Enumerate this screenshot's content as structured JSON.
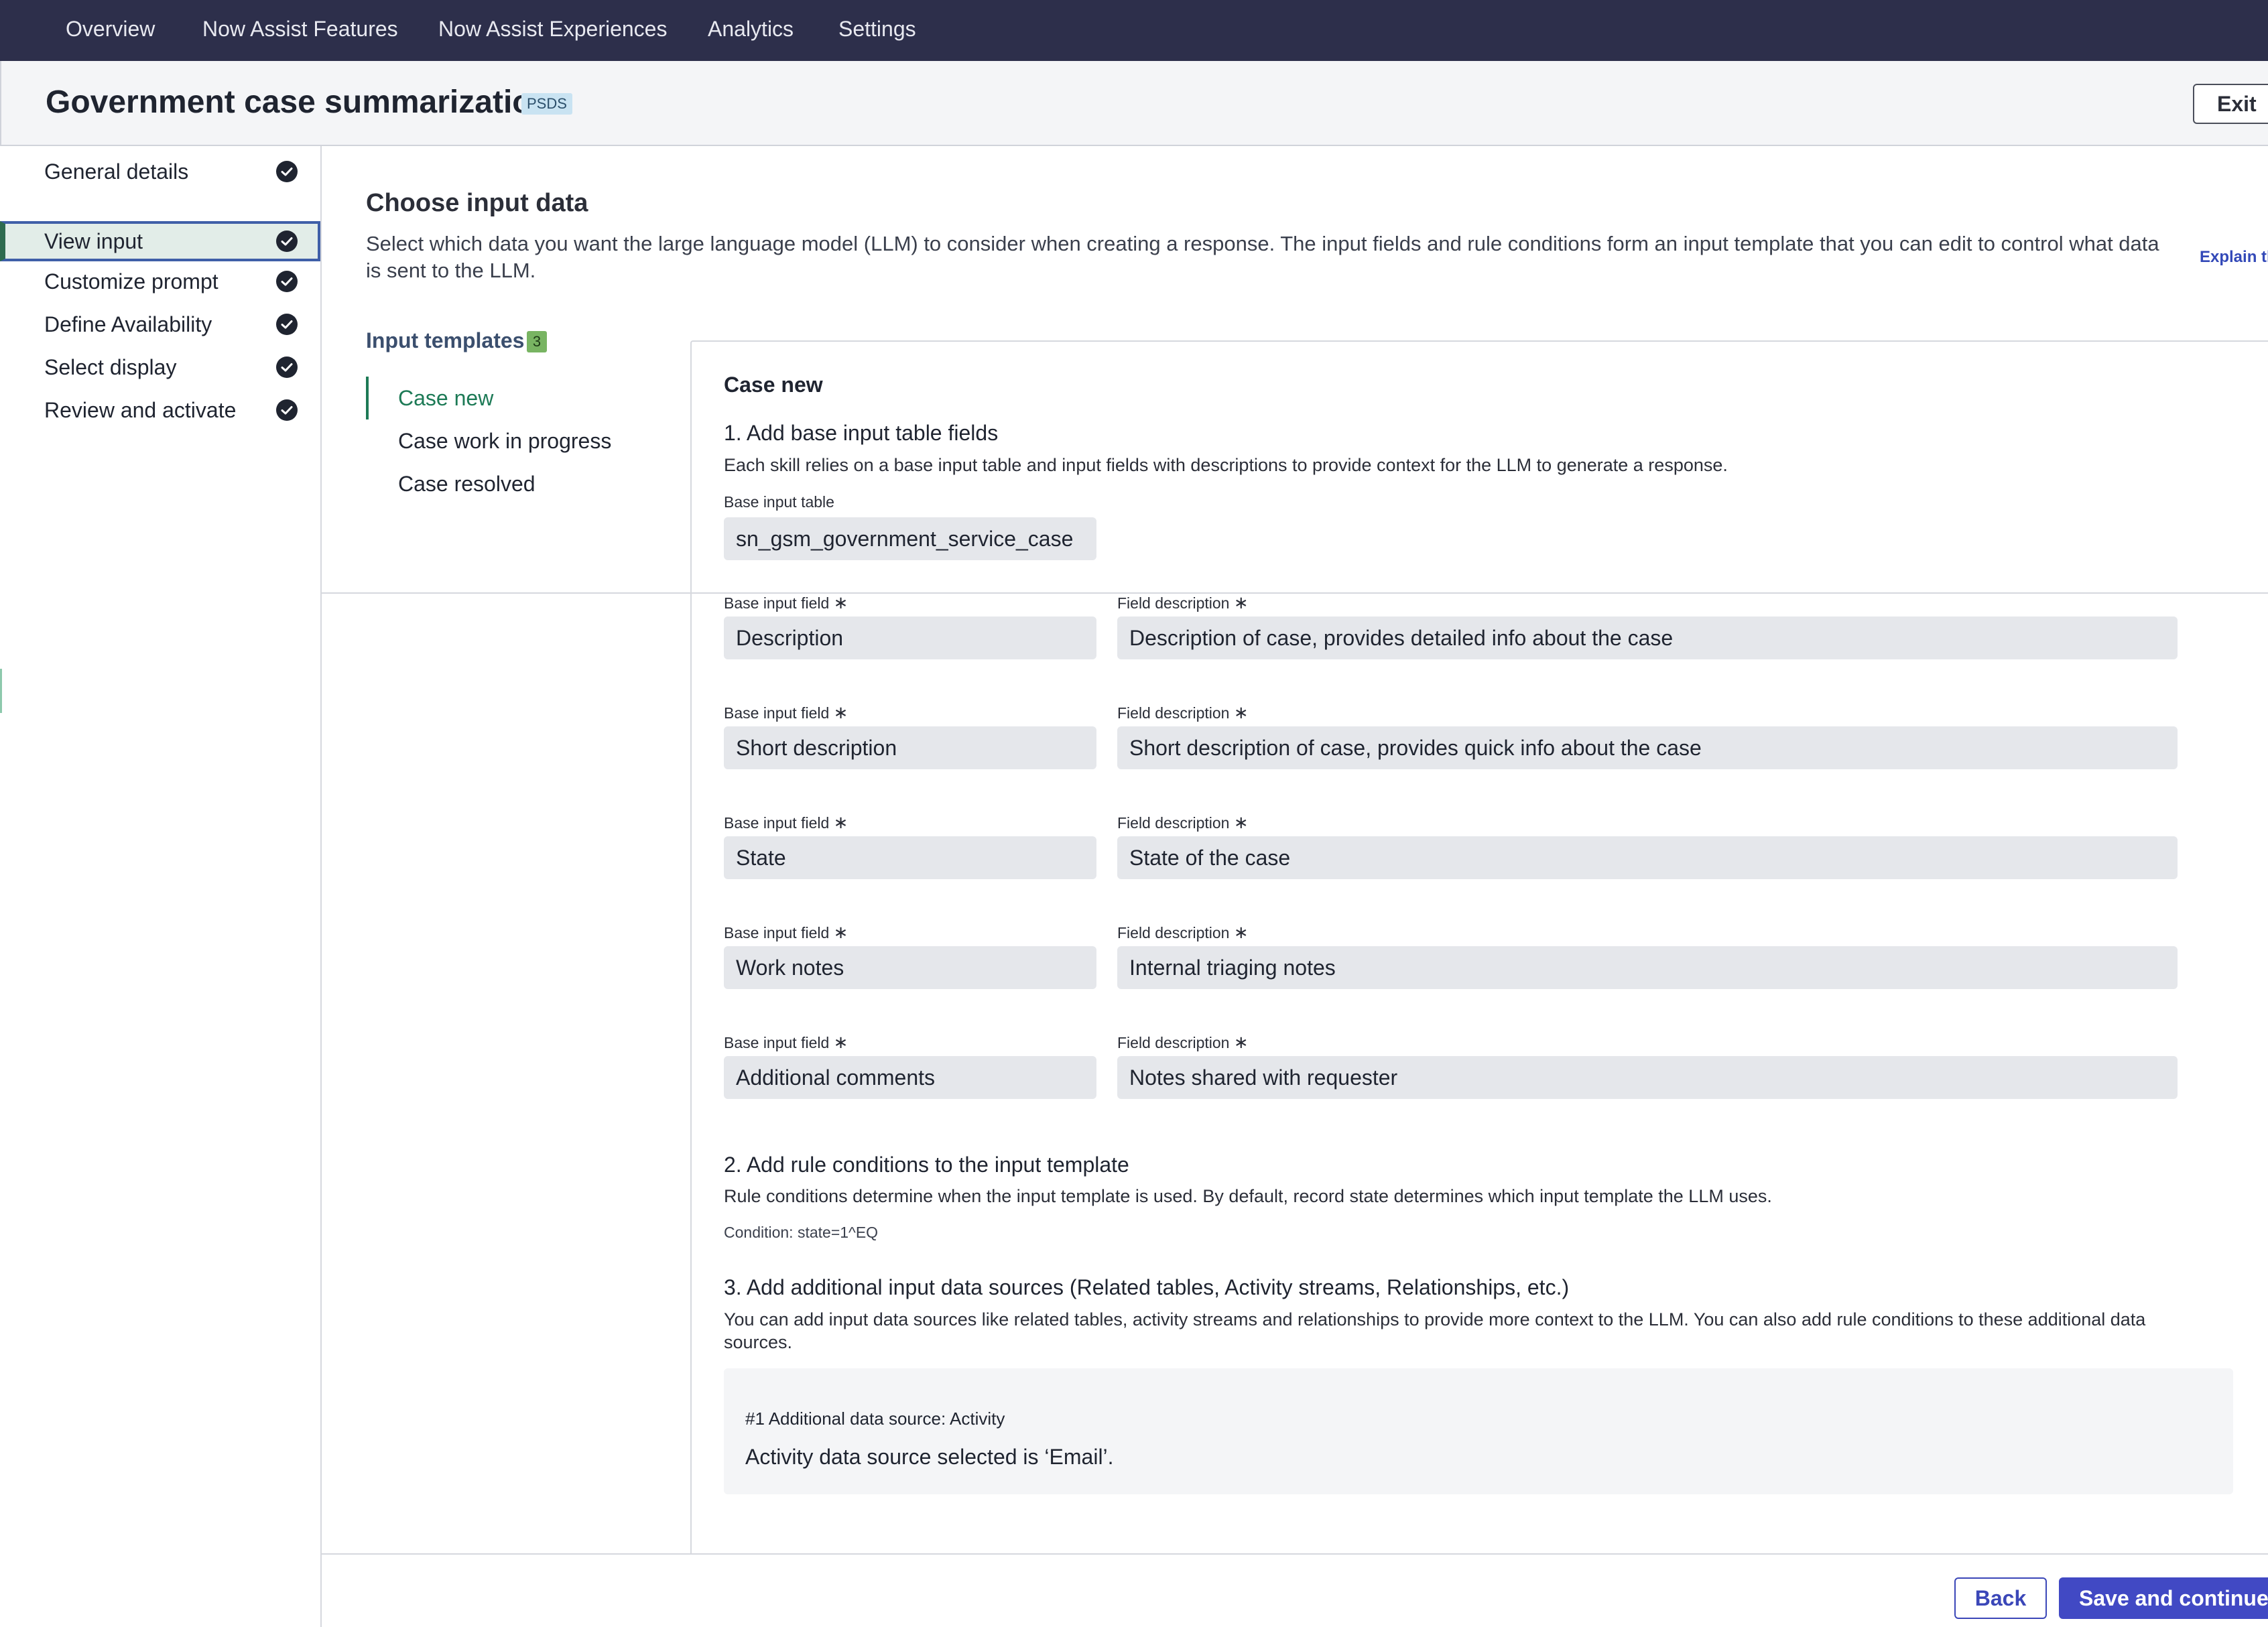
{
  "nav": {
    "items": [
      {
        "label": "Overview"
      },
      {
        "label": "Now Assist Features"
      },
      {
        "label": "Now Assist Experiences"
      },
      {
        "label": "Analytics"
      },
      {
        "label": "Settings"
      }
    ]
  },
  "header": {
    "title": "Government case summarization",
    "badge": "PSDS",
    "exit_label": "Exit"
  },
  "stepper": {
    "steps": [
      {
        "label": "General details",
        "icon": "check-circle-icon"
      },
      {
        "label": "View input",
        "icon": "check-circle-icon",
        "active": true
      },
      {
        "label": "Customize prompt",
        "icon": "check-circle-icon"
      },
      {
        "label": "Define Availability",
        "icon": "check-circle-icon"
      },
      {
        "label": "Select display",
        "icon": "check-circle-icon"
      },
      {
        "label": "Review and activate",
        "icon": "check-circle-icon"
      }
    ]
  },
  "main": {
    "title": "Choose input data",
    "description": "Select which data you want the large language model (LLM) to consider when creating a response. The input fields and rule conditions form an input template that you can edit to control what data is sent to the LLM.",
    "explain_link": "Explain th"
  },
  "templates": {
    "title": "Input templates",
    "count": "3",
    "items": [
      {
        "label": "Case new",
        "active": true
      },
      {
        "label": "Case work in progress"
      },
      {
        "label": "Case resolved"
      }
    ]
  },
  "card": {
    "title": "Case new",
    "section1": {
      "title": "1. Add base input table fields",
      "description": "Each skill relies on a base input table and input fields with descriptions to provide context for the LLM to generate a response.",
      "table_label": "Base input table",
      "table_value": "sn_gsm_government_service_case",
      "field_label": "Base input field",
      "desc_label": "Field description",
      "required_mark": "∗",
      "rows": [
        {
          "field": "Description",
          "description": "Description of case, provides detailed info about the case"
        },
        {
          "field": "Short description",
          "description": "Short description of case, provides quick info about the case"
        },
        {
          "field": "State",
          "description": "State of the case"
        },
        {
          "field": "Work notes",
          "description": "Internal triaging notes"
        },
        {
          "field": "Additional comments",
          "description": "Notes shared with requester"
        }
      ]
    },
    "section2": {
      "title": "2. Add rule conditions to the input template",
      "description": "Rule conditions determine when the input template is used. By default, record state determines which input template the LLM uses.",
      "condition": "Condition: state=1^EQ"
    },
    "section3": {
      "title": "3. Add additional input data sources (Related tables, Activity streams, Relationships, etc.)",
      "description": "You can add input data sources like related tables, activity streams and relationships to provide more context to the LLM. You can also add rule conditions to these additional data sources.",
      "source_title": "#1 Additional data source: Activity",
      "source_text": "Activity data source selected is ‘Email’."
    }
  },
  "footer": {
    "back_label": "Back",
    "save_label": "Save and continue"
  },
  "colors": {
    "nav_bg": "#2d2f4b",
    "accent": "#4149c4",
    "active_green": "#1d7a56",
    "field_bg": "#e5e7eb"
  }
}
